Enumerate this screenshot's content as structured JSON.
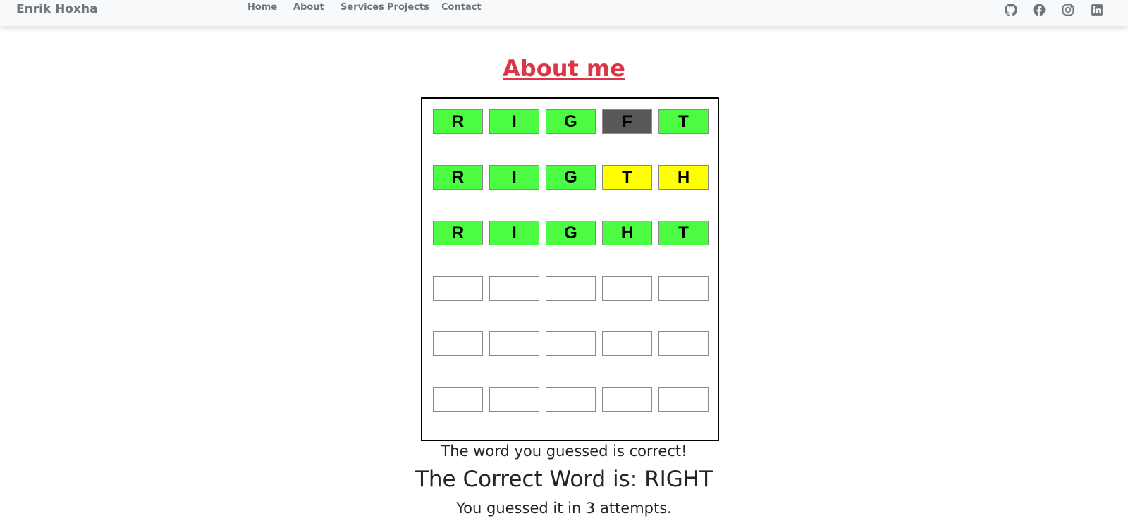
{
  "nav": {
    "brand": "Enrik Hoxha",
    "links": [
      {
        "label": "Home"
      },
      {
        "label": "About"
      },
      {
        "label": "Services"
      },
      {
        "label": "Projects"
      },
      {
        "label": "Contact"
      }
    ],
    "social": [
      {
        "icon": "github-icon"
      },
      {
        "icon": "facebook-icon"
      },
      {
        "icon": "instagram-icon"
      },
      {
        "icon": "linkedin-icon"
      }
    ]
  },
  "page": {
    "title": "About me"
  },
  "colors": {
    "green": "#4bfc42",
    "yellow": "#ffff00",
    "gray": "#585858",
    "title": "#dc3545"
  },
  "board": {
    "rows": [
      [
        {
          "letter": "R",
          "state": "green"
        },
        {
          "letter": "I",
          "state": "green"
        },
        {
          "letter": "G",
          "state": "green"
        },
        {
          "letter": "F",
          "state": "gray"
        },
        {
          "letter": "T",
          "state": "green"
        }
      ],
      [
        {
          "letter": "R",
          "state": "green"
        },
        {
          "letter": "I",
          "state": "green"
        },
        {
          "letter": "G",
          "state": "green"
        },
        {
          "letter": "T",
          "state": "yellow"
        },
        {
          "letter": "H",
          "state": "yellow"
        }
      ],
      [
        {
          "letter": "R",
          "state": "green"
        },
        {
          "letter": "I",
          "state": "green"
        },
        {
          "letter": "G",
          "state": "green"
        },
        {
          "letter": "H",
          "state": "green"
        },
        {
          "letter": "T",
          "state": "green"
        }
      ],
      [
        {
          "letter": "",
          "state": "empty"
        },
        {
          "letter": "",
          "state": "empty"
        },
        {
          "letter": "",
          "state": "empty"
        },
        {
          "letter": "",
          "state": "empty"
        },
        {
          "letter": "",
          "state": "empty"
        }
      ],
      [
        {
          "letter": "",
          "state": "empty"
        },
        {
          "letter": "",
          "state": "empty"
        },
        {
          "letter": "",
          "state": "empty"
        },
        {
          "letter": "",
          "state": "empty"
        },
        {
          "letter": "",
          "state": "empty"
        }
      ],
      [
        {
          "letter": "",
          "state": "empty"
        },
        {
          "letter": "",
          "state": "empty"
        },
        {
          "letter": "",
          "state": "empty"
        },
        {
          "letter": "",
          "state": "empty"
        },
        {
          "letter": "",
          "state": "empty"
        }
      ]
    ]
  },
  "result": {
    "message": "The word you guessed is correct!",
    "correct_word": "The Correct Word is: RIGHT",
    "attempts": "You guessed it in 3 attempts."
  }
}
